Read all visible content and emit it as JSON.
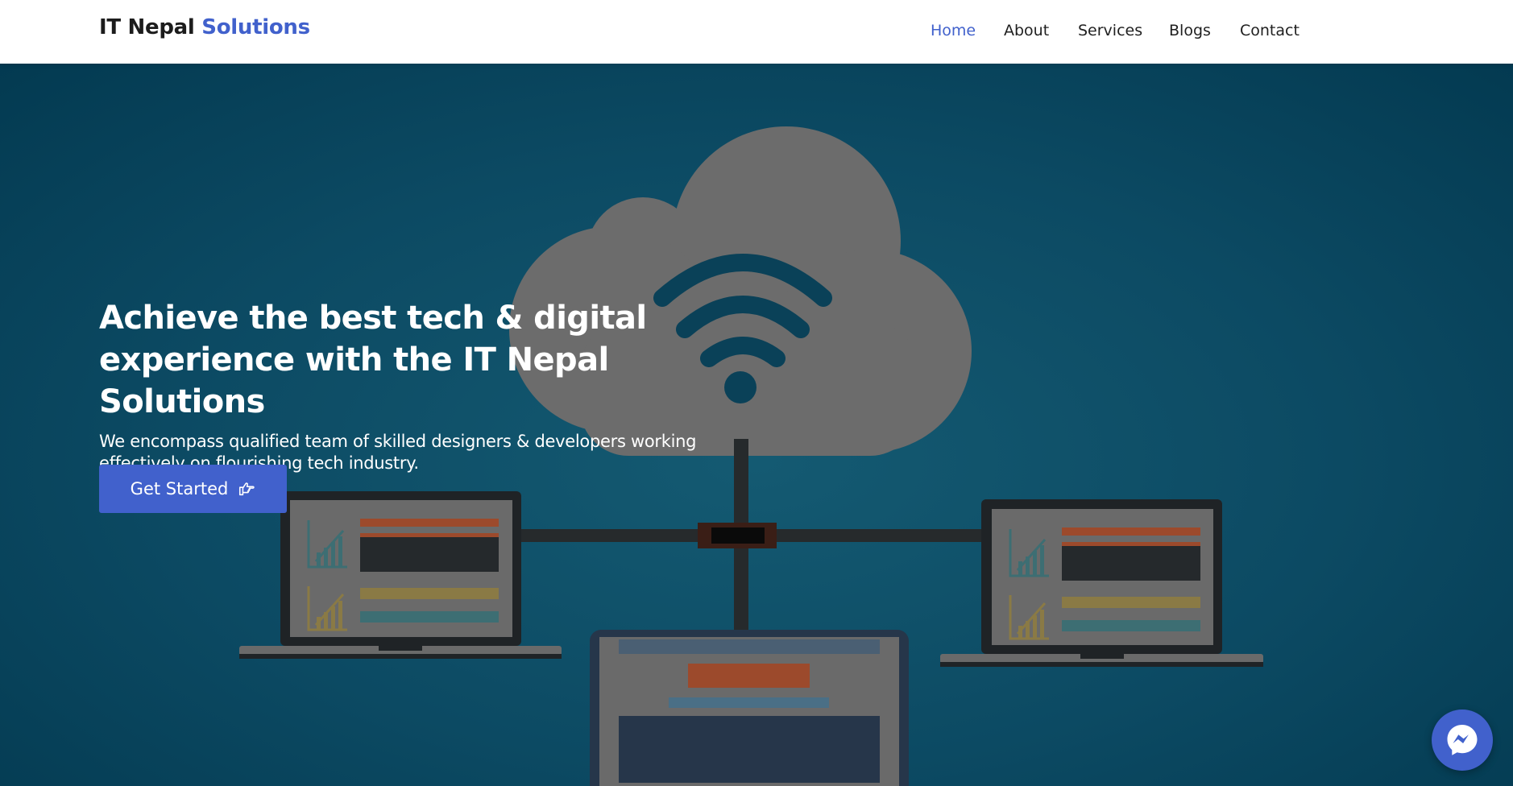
{
  "brand": {
    "name_part1": "IT Nepal",
    "name_part2": "Solutions"
  },
  "nav": {
    "items": [
      {
        "label": "Home",
        "active": true
      },
      {
        "label": "About",
        "active": false
      },
      {
        "label": "Services",
        "active": false
      },
      {
        "label": "Blogs",
        "active": false
      },
      {
        "label": "Contact",
        "active": false
      }
    ]
  },
  "hero": {
    "title_line1": "Achieve the best tech & digital",
    "title_line2": "experience with the IT Nepal Solutions",
    "subtitle_line1": "We encompass qualified team of skilled designers & developers working",
    "subtitle_line2": "effectively on flourishing tech industry.",
    "cta_label": "Get Started",
    "cta_icon": "hand-point-right-icon"
  },
  "messenger": {
    "icon": "messenger-icon"
  },
  "colors": {
    "accent": "#4161cc",
    "hero_bg": "#0c4a63",
    "nav_text": "#1f1f1f"
  }
}
